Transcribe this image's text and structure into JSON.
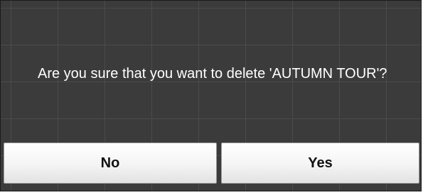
{
  "dialog": {
    "message": "Are you sure that you want to delete 'AUTUMN TOUR'?",
    "buttons": {
      "no_label": "No",
      "yes_label": "Yes"
    }
  },
  "colors": {
    "dialog_background": "#3b3b3b",
    "grid_lines": "#4b4b4b",
    "message_text": "#ffffff",
    "button_background": "#f4f4f4",
    "button_text": "#111111"
  }
}
